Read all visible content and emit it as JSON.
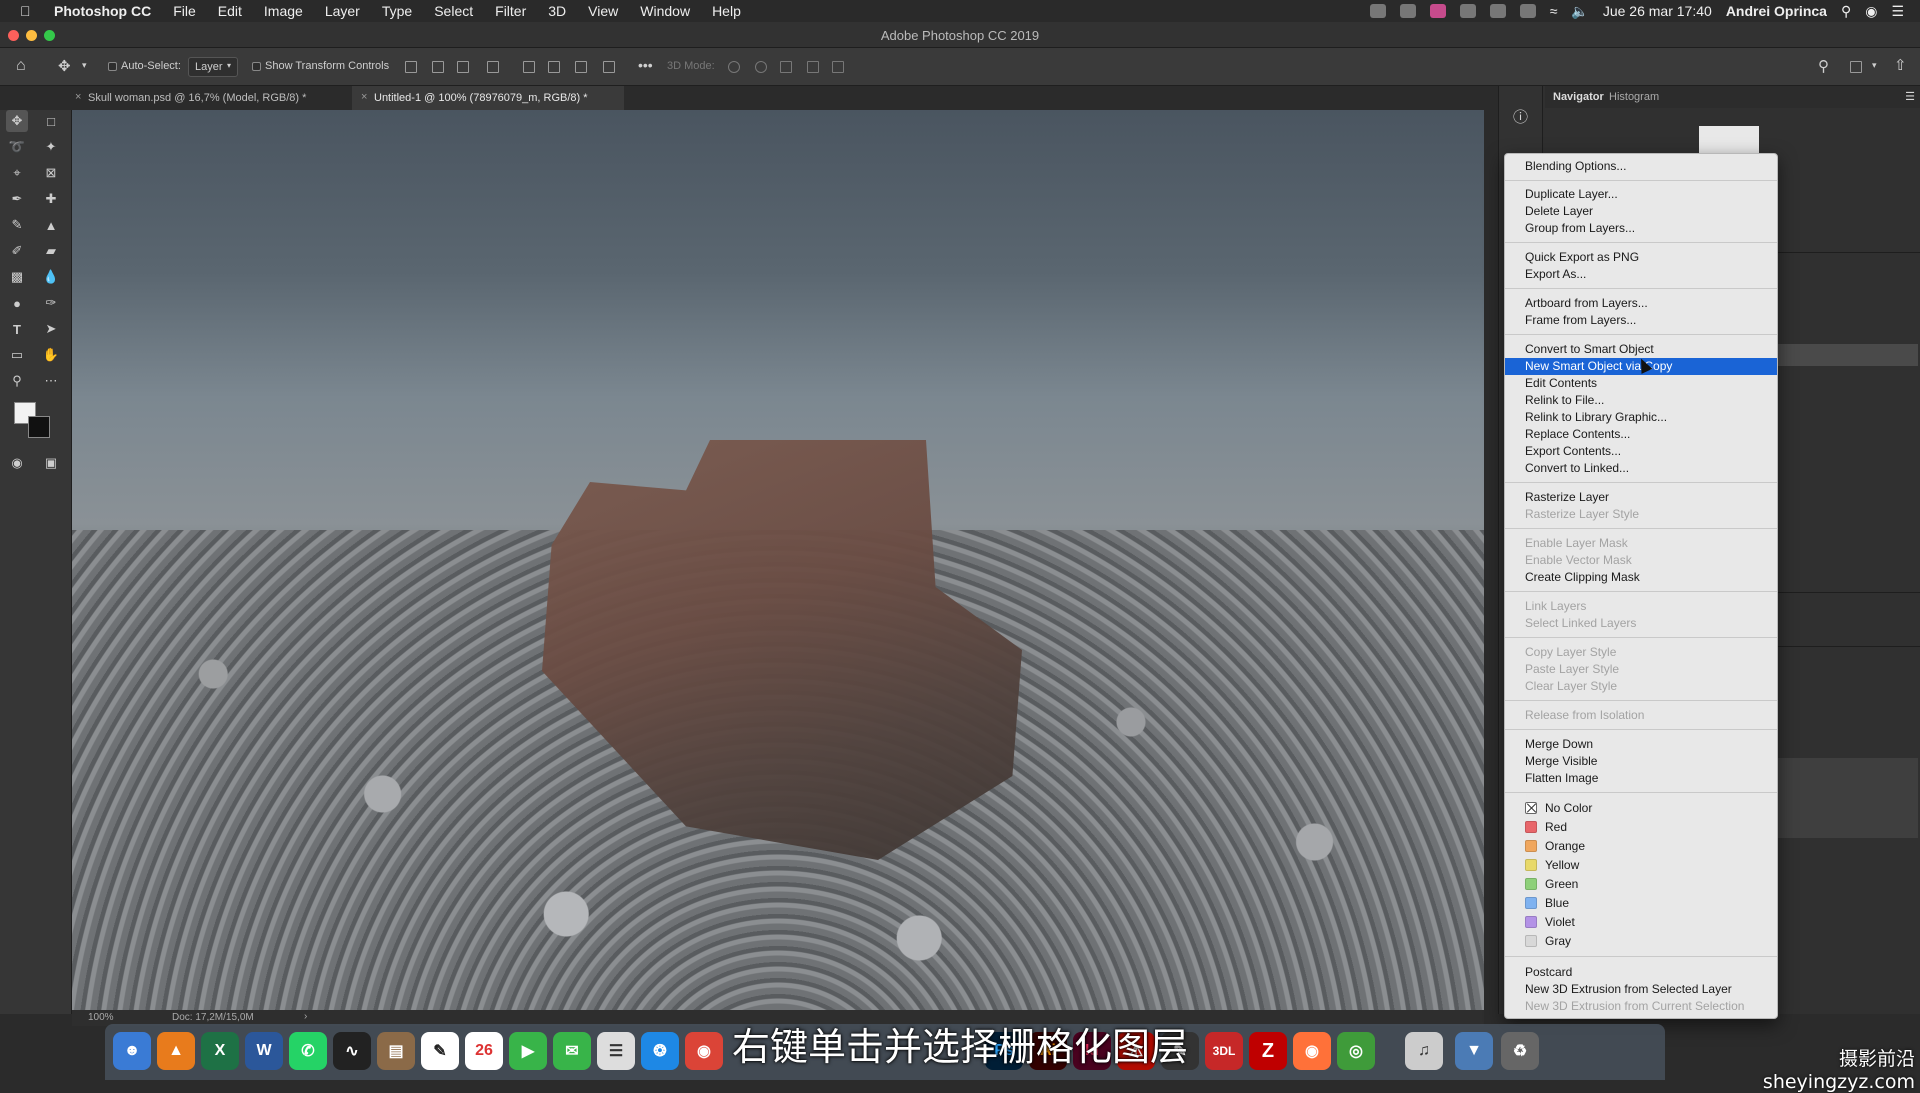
{
  "menubar": {
    "app": "Photoshop CC",
    "items": [
      "File",
      "Edit",
      "Image",
      "Layer",
      "Type",
      "Select",
      "Filter",
      "3D",
      "View",
      "Window",
      "Help"
    ],
    "datetime": "Jue 26 mar  17:40",
    "user": "Andrei Oprinca"
  },
  "window": {
    "title": "Adobe Photoshop CC 2019"
  },
  "options": {
    "auto_select_label": "Auto-Select:",
    "auto_select_value": "Layer",
    "transform_label": "Show Transform Controls",
    "mode_3d": "3D Mode:"
  },
  "tabs": [
    {
      "label": "Skull woman.psd @ 16,7% (Model, RGB/8) *"
    },
    {
      "label": "Untitled-1 @ 100% (78976079_m, RGB/8) *"
    }
  ],
  "status": {
    "zoom": "100%",
    "doc": "Doc: 17,2M/15,0M"
  },
  "panels": {
    "tab1": "Navigator",
    "tab2": "Histogram"
  },
  "context_menu": {
    "items": [
      {
        "label": "Blending Options...",
        "state": "normal"
      },
      {
        "label": "Duplicate Layer...",
        "state": "normal"
      },
      {
        "label": "Delete Layer",
        "state": "normal"
      },
      {
        "label": "Group from Layers...",
        "state": "normal"
      },
      {
        "label": "Quick Export as PNG",
        "state": "normal"
      },
      {
        "label": "Export As...",
        "state": "normal"
      },
      {
        "label": "Artboard from Layers...",
        "state": "normal"
      },
      {
        "label": "Frame from Layers...",
        "state": "normal"
      },
      {
        "label": "Convert to Smart Object",
        "state": "normal"
      },
      {
        "label": "New Smart Object via Copy",
        "state": "highlighted"
      },
      {
        "label": "Edit Contents",
        "state": "normal"
      },
      {
        "label": "Relink to File...",
        "state": "normal"
      },
      {
        "label": "Relink to Library Graphic...",
        "state": "normal"
      },
      {
        "label": "Replace Contents...",
        "state": "normal"
      },
      {
        "label": "Export Contents...",
        "state": "normal"
      },
      {
        "label": "Convert to Linked...",
        "state": "normal"
      },
      {
        "label": "Rasterize Layer",
        "state": "normal"
      },
      {
        "label": "Rasterize Layer Style",
        "state": "disabled"
      },
      {
        "label": "Enable Layer Mask",
        "state": "disabled"
      },
      {
        "label": "Enable Vector Mask",
        "state": "disabled"
      },
      {
        "label": "Create Clipping Mask",
        "state": "normal"
      },
      {
        "label": "Link Layers",
        "state": "disabled"
      },
      {
        "label": "Select Linked Layers",
        "state": "disabled"
      },
      {
        "label": "Copy Layer Style",
        "state": "disabled"
      },
      {
        "label": "Paste Layer Style",
        "state": "disabled"
      },
      {
        "label": "Clear Layer Style",
        "state": "disabled"
      },
      {
        "label": "Release from Isolation",
        "state": "disabled"
      },
      {
        "label": "Merge Down",
        "state": "normal"
      },
      {
        "label": "Merge Visible",
        "state": "normal"
      },
      {
        "label": "Flatten Image",
        "state": "normal"
      }
    ],
    "colors": [
      {
        "label": "No Color",
        "color": "none"
      },
      {
        "label": "Red",
        "color": "#e8666a"
      },
      {
        "label": "Orange",
        "color": "#f0a75e"
      },
      {
        "label": "Yellow",
        "color": "#e8d96a"
      },
      {
        "label": "Green",
        "color": "#8ed07a"
      },
      {
        "label": "Blue",
        "color": "#7fb2f0"
      },
      {
        "label": "Violet",
        "color": "#b392e6"
      },
      {
        "label": "Gray",
        "color": "#d8d8d8"
      }
    ],
    "footer": [
      {
        "label": "Postcard",
        "state": "normal"
      },
      {
        "label": "New 3D Extrusion from Selected Layer",
        "state": "normal"
      },
      {
        "label": "New 3D Extrusion from Current Selection",
        "state": "disabled"
      }
    ]
  },
  "dock": {
    "apps": [
      "Finder",
      "VLC",
      "X",
      "W",
      "WhatsApp",
      "Activity",
      "Notes",
      "Calendar",
      "FaceTime",
      "Messages",
      "Preview",
      "Safari",
      "Chrome",
      "Ps",
      "Ai",
      "Id",
      "Acrobat",
      "Claquette",
      "3DL",
      "FileZilla",
      "Firefox",
      "Camera",
      "Music"
    ],
    "calendar_day": "26"
  },
  "subtitle": "右键单击并选择栅格化图层",
  "watermark": "摄影前沿sheyingzyz.com",
  "accent": "#1a64d6"
}
